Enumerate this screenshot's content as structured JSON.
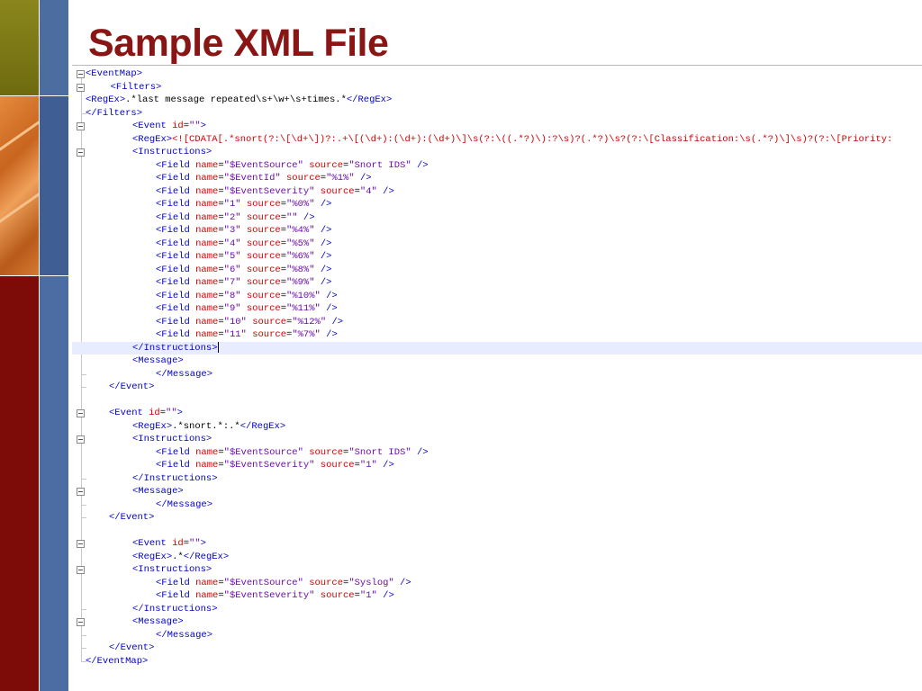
{
  "slide": {
    "title": "Sample XML File"
  },
  "colors": {
    "title": "#8a1515",
    "tag": "#0000c8",
    "attribute": "#d20000",
    "value": "#6a0dad",
    "highlight": "#e8ecff"
  },
  "code": {
    "lines": [
      "<EventMap>",
      "  <Filters>",
      "<RegEx>.*last message repeated\\s+\\w+\\s+times.*</RegEx>",
      "</Filters>",
      "<Event id=\"\">",
      "<RegEx><![CDATA[.*snort(?:\\[\\d+\\])?:.+\\[(\\d+):(\\d+):(\\d+)\\]\\s(?:\\((.*?)\\):?\\s)?(.*?)\\s?(?:\\[Classification:\\s(.*?)\\]\\s)?(?:\\[Priority:",
      "<Instructions>",
      "<Field name=\"$EventSource\" source=\"Snort IDS\" />",
      "<Field name=\"$EventId\" source=\"%1%\" />",
      "<Field name=\"$EventSeverity\" source=\"4\" />",
      "<Field name=\"1\" source=\"%0%\" />",
      "<Field name=\"2\" source=\"\" />",
      "<Field name=\"3\" source=\"%4%\" />",
      "<Field name=\"4\" source=\"%5%\" />",
      "<Field name=\"5\" source=\"%6%\" />",
      "<Field name=\"6\" source=\"%8%\" />",
      "<Field name=\"7\" source=\"%9%\" />",
      "<Field name=\"8\" source=\"%10%\" />",
      "<Field name=\"9\" source=\"%11%\" />",
      "<Field name=\"10\" source=\"%12%\" />",
      "<Field name=\"11\" source=\"%7%\" />",
      "</Instructions>",
      "<Message>",
      "</Message>",
      "</Event>",
      "",
      "<Event id=\"\">",
      "<RegEx>.*snort.*:.*</RegEx>",
      "<Instructions>",
      "<Field name=\"$EventSource\" source=\"Snort IDS\" />",
      "<Field name=\"$EventSeverity\" source=\"1\" />",
      "</Instructions>",
      "<Message>",
      "</Message>",
      "</Event>",
      "",
      "<Event id=\"\">",
      "<RegEx>.*</RegEx>",
      "<Instructions>",
      "<Field name=\"$EventSource\" source=\"Syslog\" />",
      "<Field name=\"$EventSeverity\" source=\"1\" />",
      "</Instructions>",
      "<Message>",
      "</Message>",
      "</Event>",
      "</EventMap>"
    ]
  }
}
